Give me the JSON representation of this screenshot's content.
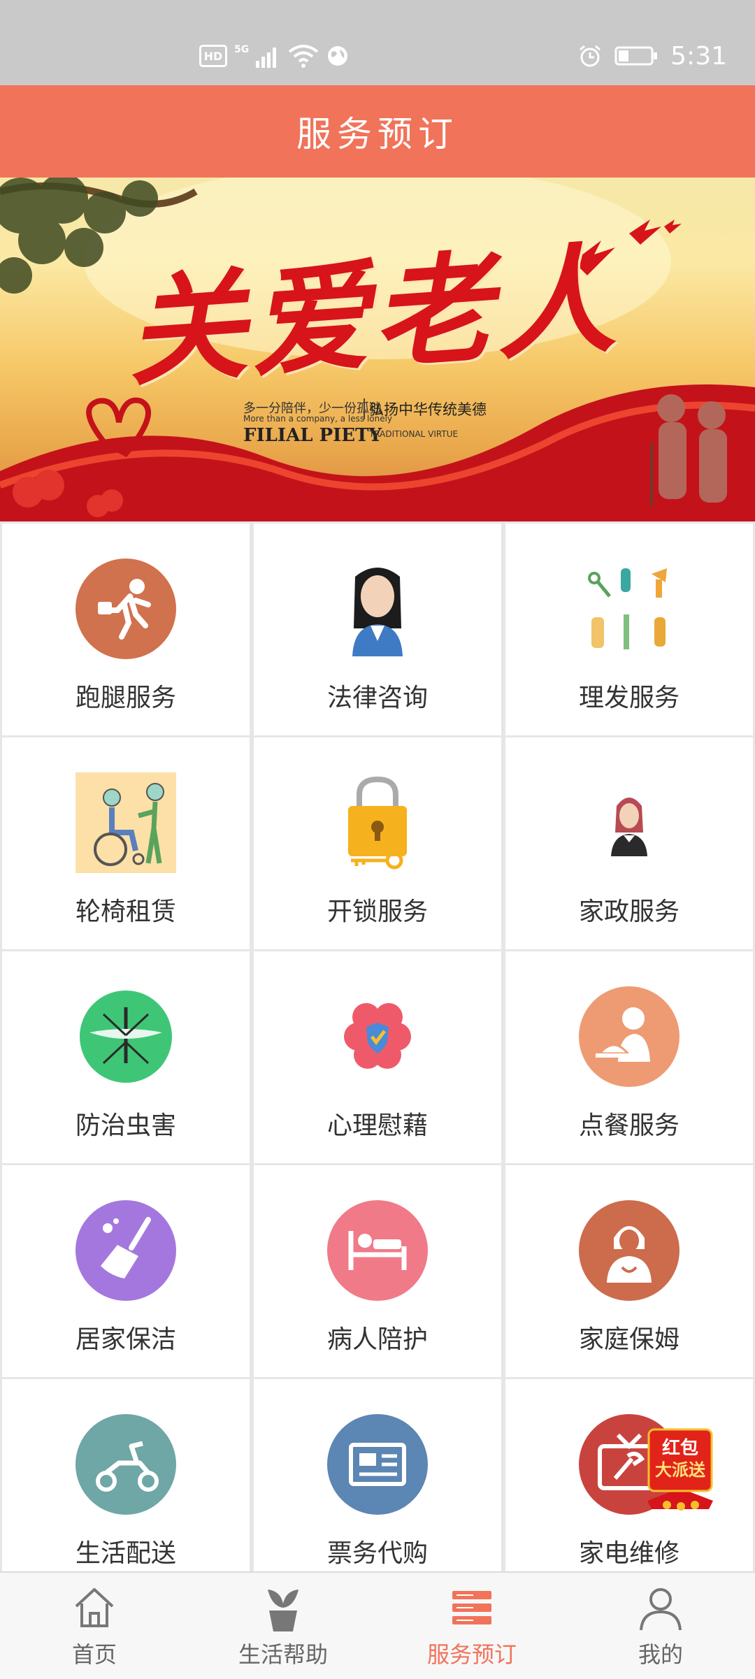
{
  "status_bar": {
    "time": "5:31",
    "hd": "HD",
    "network": "5G"
  },
  "header": {
    "title": "服务预订"
  },
  "banner": {
    "title": "关爱老人",
    "sub_cn": "多一分陪伴，少一份孤独",
    "sub_en": "More than a company, a less lonely",
    "slogan": "弘扬中华传统美德",
    "filial": "FILIAL PIETY",
    "trad": "TRADITIONAL VIRTUE"
  },
  "services": [
    {
      "label": "跑腿服务",
      "icon": "runner-icon",
      "color": "#d0724d"
    },
    {
      "label": "法律咨询",
      "icon": "lawyer-icon",
      "color": "#3c78bd"
    },
    {
      "label": "理发服务",
      "icon": "barber-tools-icon",
      "color": "#e8a93a"
    },
    {
      "label": "轮椅租赁",
      "icon": "wheelchair-icon",
      "color": "#fce0a8"
    },
    {
      "label": "开锁服务",
      "icon": "padlock-icon",
      "color": "#f6b11e"
    },
    {
      "label": "家政服务",
      "icon": "housekeeper-icon",
      "color": "#b74a52"
    },
    {
      "label": "防治虫害",
      "icon": "mosquito-icon",
      "color": "#3ec676"
    },
    {
      "label": "心理慰藉",
      "icon": "brain-shield-icon",
      "color": "#ef5a6b"
    },
    {
      "label": "点餐服务",
      "icon": "waiter-icon",
      "color": "#ee9b73"
    },
    {
      "label": "居家保洁",
      "icon": "broom-icon",
      "color": "#a477de"
    },
    {
      "label": "病人陪护",
      "icon": "hospital-bed-icon",
      "color": "#f07a88"
    },
    {
      "label": "家庭保姆",
      "icon": "nanny-icon",
      "color": "#cd6b4d"
    },
    {
      "label": "生活配送",
      "icon": "scooter-icon",
      "color": "#6fa6a6"
    },
    {
      "label": "票务代购",
      "icon": "ticket-icon",
      "color": "#5c86b3"
    },
    {
      "label": "家电维修",
      "icon": "tv-repair-icon",
      "color": "#c9433e"
    }
  ],
  "red_envelope": {
    "line1": "红包",
    "line2": "大派送"
  },
  "tabs": [
    {
      "label": "首页",
      "icon": "home-icon"
    },
    {
      "label": "生活帮助",
      "icon": "plant-pot-icon"
    },
    {
      "label": "服务预订",
      "icon": "list-icon",
      "active": true
    },
    {
      "label": "我的",
      "icon": "user-icon"
    }
  ],
  "colors": {
    "header": "#f0735a",
    "status_bar": "#c9c9c9",
    "active_tab": "#f0735a"
  }
}
